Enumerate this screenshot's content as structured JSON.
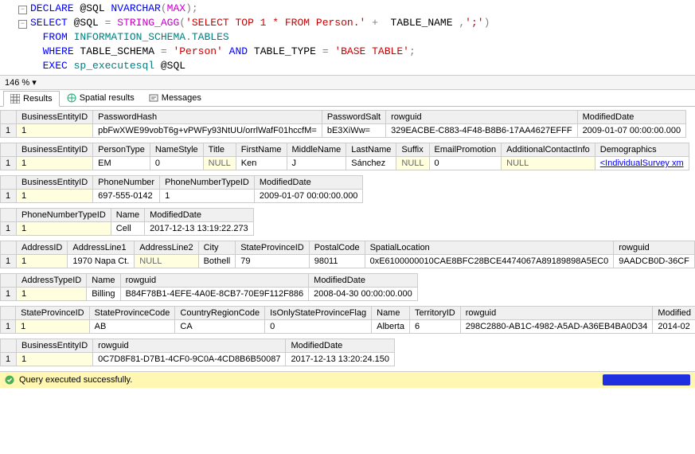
{
  "code": {
    "line1": {
      "decl": "DECLARE",
      "var": " @SQL ",
      "type": "NVARCHAR",
      "paren1": "(",
      "max": "MAX",
      "paren2": ");"
    },
    "line2": {
      "sel": "SELECT",
      "var": " @SQL ",
      "eq": "= ",
      "fn": "STRING_AGG",
      "p1": "(",
      "s1": "'SELECT TOP 1 * FROM Person.'",
      "plus": " + ",
      "col": " TABLE_NAME ",
      "comma": ",",
      "s2": "';'",
      "p2": ")"
    },
    "line3": {
      "pad": "  ",
      "from": "FROM",
      "schema": " INFORMATION_SCHEMA",
      "dot": ".",
      "tables": "TABLES"
    },
    "line4": {
      "pad": "  ",
      "where": "WHERE",
      "c1": " TABLE_SCHEMA ",
      "eq1": "= ",
      "s1": "'Person'",
      "and": " AND ",
      "c2": "TABLE_TYPE ",
      "eq2": "= ",
      "s2": "'BASE TABLE'",
      "sc": ";"
    },
    "line5": {
      "pad": "  ",
      "exec": "EXEC",
      "sp": " sp_executesql",
      "var": " @SQL"
    }
  },
  "zoom": "146 %",
  "tabs": {
    "results": "Results",
    "spatial": "Spatial results",
    "messages": "Messages"
  },
  "grids": [
    {
      "columns": [
        "BusinessEntityID",
        "PasswordHash",
        "PasswordSalt",
        "rowguid",
        "ModifiedDate"
      ],
      "row": [
        "1",
        "pbFwXWE99vobT6g+vPWFy93NtUU/orrlWafF01hccfM=",
        "bE3XiWw=",
        "329EACBE-C883-4F48-B8B6-17AA4627EFFF",
        "2009-01-07 00:00:00.000"
      ]
    },
    {
      "columns": [
        "BusinessEntityID",
        "PersonType",
        "NameStyle",
        "Title",
        "FirstName",
        "MiddleName",
        "LastName",
        "Suffix",
        "EmailPromotion",
        "AdditionalContactInfo",
        "Demographics"
      ],
      "row": [
        "1",
        "EM",
        "0",
        "NULL",
        "Ken",
        "J",
        "Sánchez",
        "NULL",
        "0",
        "NULL",
        "<IndividualSurvey xm"
      ]
    },
    {
      "columns": [
        "BusinessEntityID",
        "PhoneNumber",
        "PhoneNumberTypeID",
        "ModifiedDate"
      ],
      "row": [
        "1",
        "697-555-0142",
        "1",
        "2009-01-07 00:00:00.000"
      ]
    },
    {
      "columns": [
        "PhoneNumberTypeID",
        "Name",
        "ModifiedDate"
      ],
      "row": [
        "1",
        "Cell",
        "2017-12-13 13:19:22.273"
      ]
    },
    {
      "columns": [
        "AddressID",
        "AddressLine1",
        "AddressLine2",
        "City",
        "StateProvinceID",
        "PostalCode",
        "SpatialLocation",
        "rowguid"
      ],
      "row": [
        "1",
        "1970 Napa Ct.",
        "NULL",
        "Bothell",
        "79",
        "98011",
        "0xE6100000010CAE8BFC28BCE4474067A89189898A5EC0",
        "9AADCB0D-36CF"
      ]
    },
    {
      "columns": [
        "AddressTypeID",
        "Name",
        "rowguid",
        "ModifiedDate"
      ],
      "row": [
        "1",
        "Billing",
        "B84F78B1-4EFE-4A0E-8CB7-70E9F112F886",
        "2008-04-30 00:00:00.000"
      ]
    },
    {
      "columns": [
        "StateProvinceID",
        "StateProvinceCode",
        "CountryRegionCode",
        "IsOnlyStateProvinceFlag",
        "Name",
        "TerritoryID",
        "rowguid",
        "Modified"
      ],
      "row": [
        "1",
        "AB",
        "CA",
        "0",
        "Alberta",
        "6",
        "298C2880-AB1C-4982-A5AD-A36EB4BA0D34",
        "2014-02"
      ]
    },
    {
      "columns": [
        "BusinessEntityID",
        "rowguid",
        "ModifiedDate"
      ],
      "row": [
        "1",
        "0C7D8F81-D7B1-4CF0-9C0A-4CD8B6B50087",
        "2017-12-13 13:20:24.150"
      ]
    }
  ],
  "status": "Query executed successfully."
}
